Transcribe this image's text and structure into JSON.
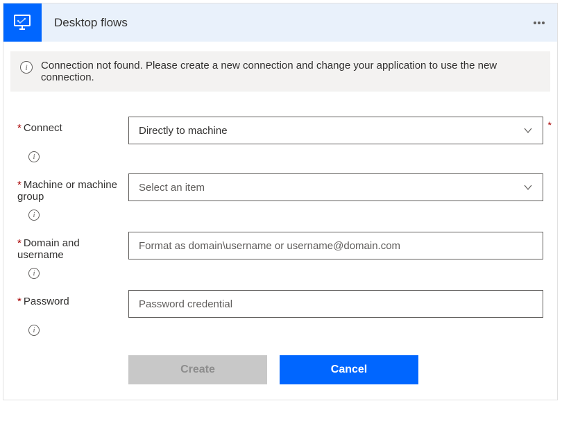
{
  "header": {
    "title": "Desktop flows",
    "icon": "desktop-flow-icon"
  },
  "alert": {
    "message": "Connection not found. Please create a new connection and change your application to use the new connection."
  },
  "fields": {
    "connect": {
      "label": "Connect",
      "value": "Directly to machine"
    },
    "machine": {
      "label": "Machine or machine group",
      "placeholder": "Select an item"
    },
    "domain": {
      "label": "Domain and username",
      "placeholder": "Format as domain\\username or username@domain.com"
    },
    "password": {
      "label": "Password",
      "placeholder": "Password credential"
    }
  },
  "buttons": {
    "create": "Create",
    "cancel": "Cancel"
  }
}
